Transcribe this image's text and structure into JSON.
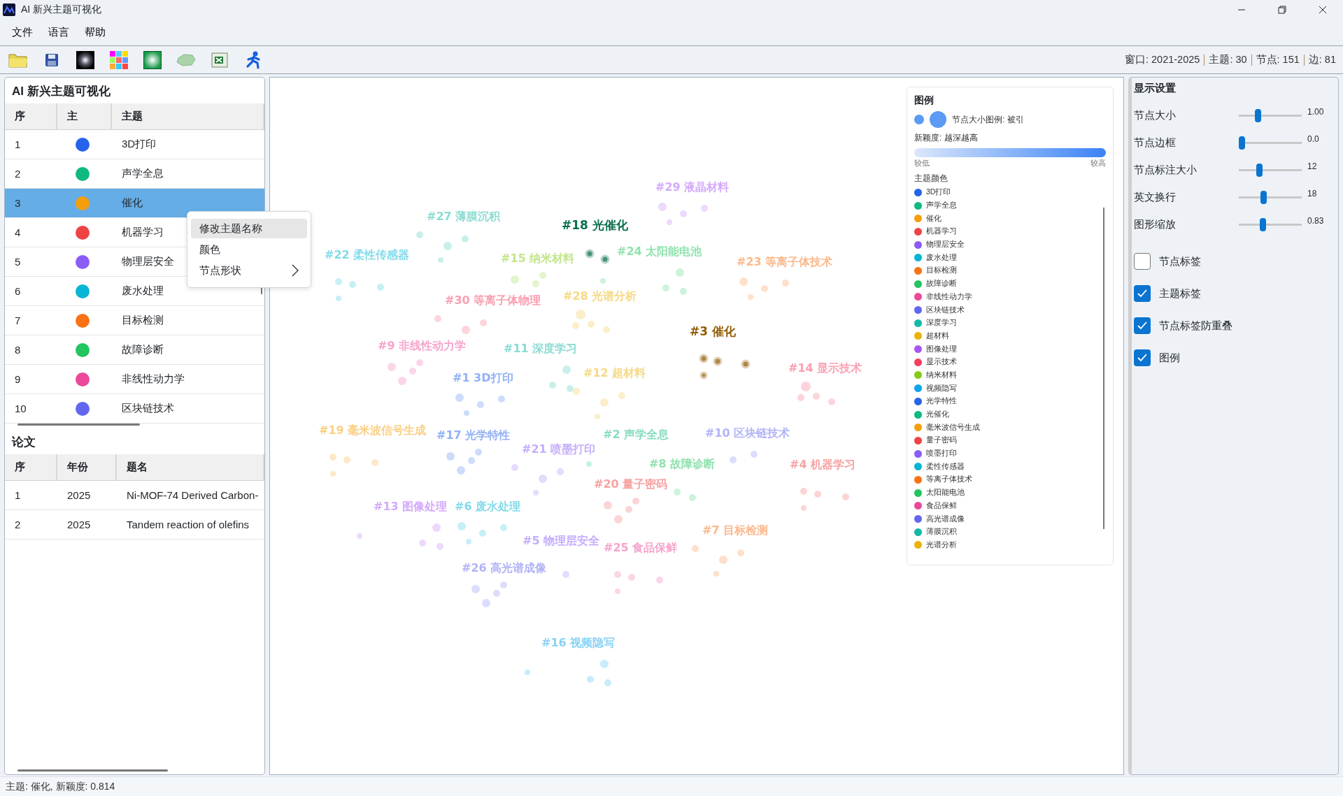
{
  "window": {
    "title": "AI 新兴主题可视化"
  },
  "menu": [
    "文件",
    "语言",
    "帮助"
  ],
  "summary": [
    "窗口: 2021-2025",
    "主题: 30",
    "节点: 151",
    "边: 81"
  ],
  "topics_panel": {
    "title": "AI 新兴主题可视化",
    "columns": [
      "序",
      "主",
      "主题"
    ],
    "rows": [
      {
        "index": "1",
        "name": "3D打印",
        "color": "#2563eb",
        "selected": false
      },
      {
        "index": "2",
        "name": "声学全息",
        "color": "#10b981",
        "selected": false
      },
      {
        "index": "3",
        "name": "催化",
        "color": "#f59e0b",
        "selected": true
      },
      {
        "index": "4",
        "name": "机器学习",
        "color": "#ef4444",
        "selected": false
      },
      {
        "index": "5",
        "name": "物理层安全",
        "color": "#8b5cf6",
        "selected": false
      },
      {
        "index": "6",
        "name": "废水处理",
        "color": "#06b6d4",
        "selected": false
      },
      {
        "index": "7",
        "name": "目标检测",
        "color": "#f97316",
        "selected": false
      },
      {
        "index": "8",
        "name": "故障诊断",
        "color": "#22c55e",
        "selected": false
      },
      {
        "index": "9",
        "name": "非线性动力学",
        "color": "#ec4899",
        "selected": false
      },
      {
        "index": "10",
        "name": "区块链技术",
        "color": "#6366f1",
        "selected": false
      }
    ]
  },
  "context_menu": {
    "items": [
      {
        "label": "修改主题名称",
        "highlighted": true,
        "submenu": false
      },
      {
        "label": "颜色",
        "highlighted": false,
        "submenu": false
      },
      {
        "label": "节点形状",
        "highlighted": false,
        "submenu": true
      }
    ]
  },
  "papers_panel": {
    "title": "论文",
    "columns": [
      "序",
      "年份",
      "题名"
    ],
    "rows": [
      {
        "index": "1",
        "year": "2025",
        "title": "Ni-MOF-74 Derived Carbon-"
      },
      {
        "index": "2",
        "year": "2025",
        "title": "Tandem reaction of olefins"
      }
    ]
  },
  "graph": {
    "labels": [
      {
        "text": "#29 液晶材料",
        "color": "#d4aafb",
        "highlighted": false
      },
      {
        "text": "#27 薄膜沉积",
        "color": "#8adcd3",
        "highlighted": false
      },
      {
        "text": "#18 光催化",
        "color": "#0a6f4d",
        "highlighted": true
      },
      {
        "text": "#22 柔性传感器",
        "color": "#83dbea",
        "highlighted": false
      },
      {
        "text": "#15 纳米材料",
        "color": "#c2e68b",
        "highlighted": false
      },
      {
        "text": "#24 太阳能电池",
        "color": "#91e2af",
        "highlighted": false
      },
      {
        "text": "#23 等离子体技术",
        "color": "#fcb98b",
        "highlighted": false
      },
      {
        "text": "#30 等离子体物理",
        "color": "#fa9faf",
        "highlighted": false
      },
      {
        "text": "#28 光谱分析",
        "color": "#f5d984",
        "highlighted": false
      },
      {
        "text": "#3 催化",
        "color": "#935f07",
        "highlighted": true
      },
      {
        "text": "#9 非线性动力学",
        "color": "#f6a4cc",
        "highlighted": false
      },
      {
        "text": "#11 深度学习",
        "color": "#8adcd3",
        "highlighted": false
      },
      {
        "text": "#1 3D打印",
        "color": "#92b1f5",
        "highlighted": false
      },
      {
        "text": "#12 超材料",
        "color": "#f5d984",
        "highlighted": false
      },
      {
        "text": "#14 显示技术",
        "color": "#fa9faf",
        "highlighted": false
      },
      {
        "text": "#19 毫米波信号生成",
        "color": "#facf85",
        "highlighted": false
      },
      {
        "text": "#17 光学特性",
        "color": "#92b1f5",
        "highlighted": false
      },
      {
        "text": "#2 声学全息",
        "color": "#88dcc0",
        "highlighted": false
      },
      {
        "text": "#10 区块链技术",
        "color": "#b1b3f8",
        "highlighted": false
      },
      {
        "text": "#21 喷墨打印",
        "color": "#c5aefb",
        "highlighted": false
      },
      {
        "text": "#8 故障诊断",
        "color": "#91e2af",
        "highlighted": false
      },
      {
        "text": "#4 机器学习",
        "color": "#f7a2a2",
        "highlighted": false
      },
      {
        "text": "#20 量子密码",
        "color": "#f7a2a2",
        "highlighted": false
      },
      {
        "text": "#13 图像处理",
        "color": "#d4aafb",
        "highlighted": false
      },
      {
        "text": "#6 废水处理",
        "color": "#83dbea",
        "highlighted": false
      },
      {
        "text": "#7 目标检测",
        "color": "#fcb98b",
        "highlighted": false
      },
      {
        "text": "#5 物理层安全",
        "color": "#c5aefb",
        "highlighted": false
      },
      {
        "text": "#25 食品保鲜",
        "color": "#f6a4cc",
        "highlighted": false
      },
      {
        "text": "#26 高光谱成像",
        "color": "#b1b3f8",
        "highlighted": false
      },
      {
        "text": "#16 视频隐写",
        "color": "#87d2f4",
        "highlighted": false
      }
    ]
  },
  "legend": {
    "title": "图例",
    "size_caption": "节点大小图例: 被引",
    "novelty_caption": "新颖度: 越深越高",
    "low": "较低",
    "high": "较高",
    "colors_title": "主题颜色",
    "items": [
      {
        "name": "3D打印",
        "color": "#2563eb"
      },
      {
        "name": "声学全息",
        "color": "#10b981"
      },
      {
        "name": "催化",
        "color": "#f59e0b"
      },
      {
        "name": "机器学习",
        "color": "#ef4444"
      },
      {
        "name": "物理层安全",
        "color": "#8b5cf6"
      },
      {
        "name": "废水处理",
        "color": "#06b6d4"
      },
      {
        "name": "目标检测",
        "color": "#f97316"
      },
      {
        "name": "故障诊断",
        "color": "#22c55e"
      },
      {
        "name": "非线性动力学",
        "color": "#ec4899"
      },
      {
        "name": "区块链技术",
        "color": "#6366f1"
      },
      {
        "name": "深度学习",
        "color": "#14b8a6"
      },
      {
        "name": "超材料",
        "color": "#eab308"
      },
      {
        "name": "图像处理",
        "color": "#a855f7"
      },
      {
        "name": "显示技术",
        "color": "#f43f5e"
      },
      {
        "name": "纳米材料",
        "color": "#84cc16"
      },
      {
        "name": "视频隐写",
        "color": "#0ea5e9"
      },
      {
        "name": "光学特性",
        "color": "#2563eb"
      },
      {
        "name": "光催化",
        "color": "#10b981"
      },
      {
        "name": "毫米波信号生成",
        "color": "#f59e0b"
      },
      {
        "name": "量子密码",
        "color": "#ef4444"
      },
      {
        "name": "喷墨打印",
        "color": "#8b5cf6"
      },
      {
        "name": "柔性传感器",
        "color": "#06b6d4"
      },
      {
        "name": "等离子体技术",
        "color": "#f97316"
      },
      {
        "name": "太阳能电池",
        "color": "#22c55e"
      },
      {
        "name": "食品保鲜",
        "color": "#ec4899"
      },
      {
        "name": "高光谱成像",
        "color": "#6366f1"
      },
      {
        "name": "薄膜沉积",
        "color": "#14b8a6"
      },
      {
        "name": "光谱分析",
        "color": "#eab308"
      }
    ]
  },
  "settings": {
    "title": "显示设置",
    "sliders": [
      {
        "label": "节点大小",
        "level": 0.28,
        "reading": "1.00"
      },
      {
        "label": "节点边框",
        "level": 0,
        "reading": "0.0"
      },
      {
        "label": "节点标注大小",
        "level": 0.31,
        "reading": "12"
      },
      {
        "label": "英文换行",
        "level": 0.38,
        "reading": "18"
      },
      {
        "label": "图形缩放",
        "level": 0.37,
        "reading": "0.83"
      }
    ],
    "checkboxes": [
      {
        "label": "节点标签",
        "checked": false
      },
      {
        "label": "主题标签",
        "checked": true
      },
      {
        "label": "节点标签防重叠",
        "checked": true
      },
      {
        "label": "图例",
        "checked": true
      }
    ]
  },
  "status_bar": "主题: 催化, 新颖度: 0.814"
}
